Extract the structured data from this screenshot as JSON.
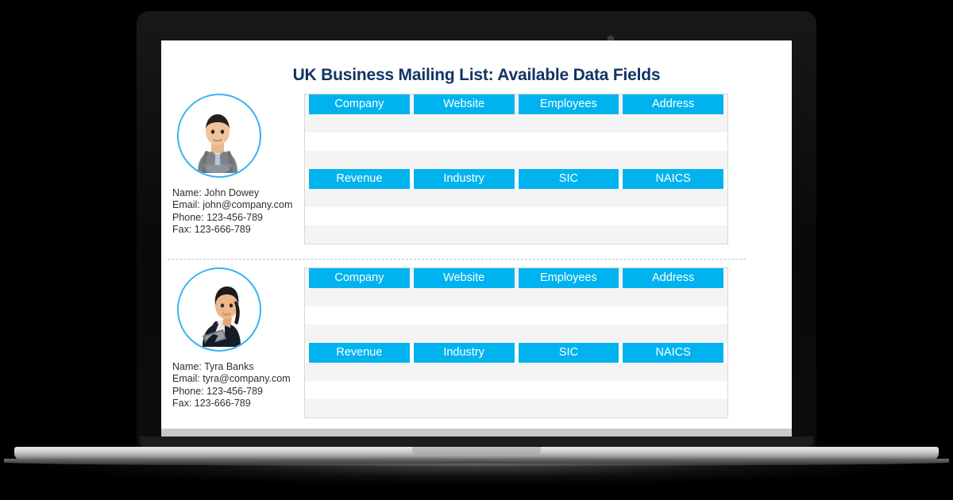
{
  "device": {
    "type": "laptop-mockup",
    "camera_icon": "camera-dot-icon"
  },
  "page": {
    "title": "UK Business Mailing List: Available Data Fields",
    "accent_color": "#00b3ef",
    "title_color": "#123463",
    "avatar_ring_color": "#35b4ef"
  },
  "sections": [
    {
      "person": {
        "avatar_icon": "male-businessman-avatar-icon",
        "name": "Name: John Dowey",
        "email": "Email: john@company.com",
        "phone": "Phone: 123-456-789",
        "fax": "Fax: 123-666-789"
      },
      "field_rows": [
        [
          "Company",
          "Website",
          "Employees",
          "Address"
        ],
        [
          "Revenue",
          "Industry",
          "SIC",
          "NAICS"
        ]
      ]
    },
    {
      "person": {
        "avatar_icon": "female-businesswoman-avatar-icon",
        "name": "Name: Tyra Banks",
        "email": "Email: tyra@company.com",
        "phone": "Phone: 123-456-789",
        "fax": "Fax: 123-666-789"
      },
      "field_rows": [
        [
          "Company",
          "Website",
          "Employees",
          "Address"
        ],
        [
          "Revenue",
          "Industry",
          "SIC",
          "NAICS"
        ]
      ]
    }
  ]
}
